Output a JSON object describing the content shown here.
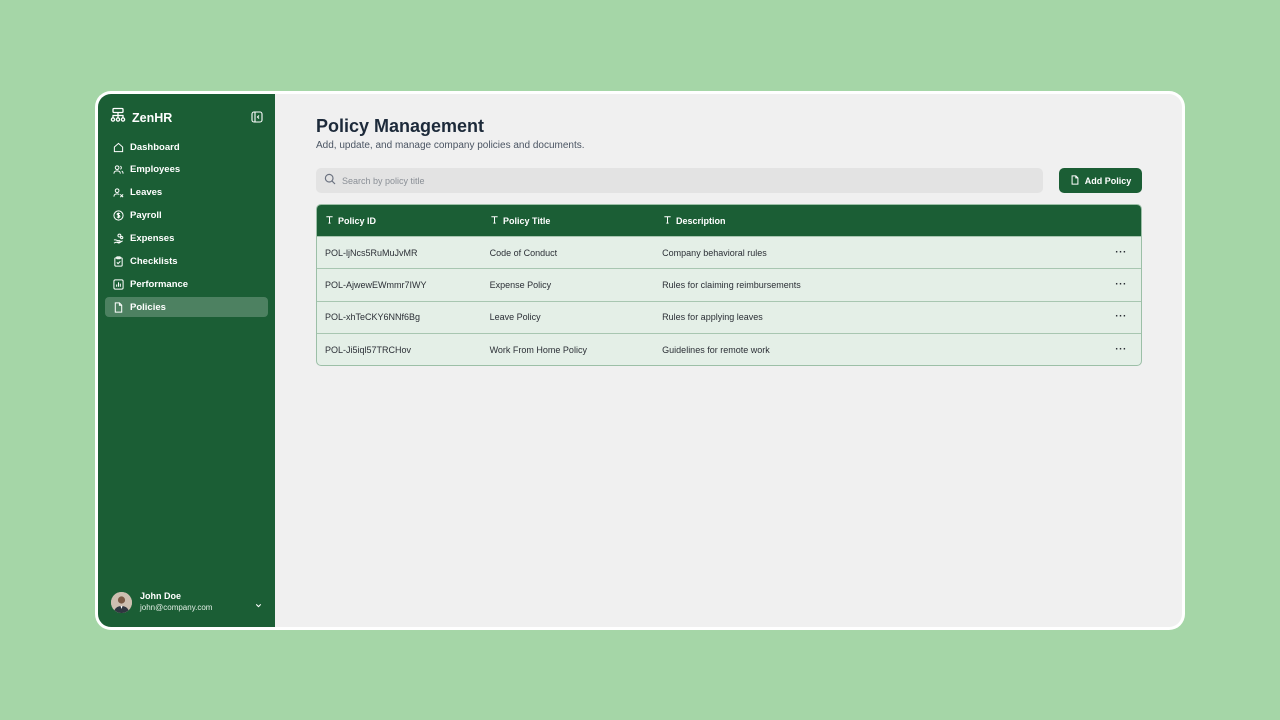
{
  "app": {
    "name": "ZenHR"
  },
  "sidebar": {
    "items": [
      {
        "label": "Dashboard",
        "icon": "home-icon",
        "active": false
      },
      {
        "label": "Employees",
        "icon": "users-icon",
        "active": false
      },
      {
        "label": "Leaves",
        "icon": "user-x-icon",
        "active": false
      },
      {
        "label": "Payroll",
        "icon": "dollar-circle-icon",
        "active": false
      },
      {
        "label": "Expenses",
        "icon": "hand-coins-icon",
        "active": false
      },
      {
        "label": "Checklists",
        "icon": "clipboard-check-icon",
        "active": false
      },
      {
        "label": "Performance",
        "icon": "bar-chart-icon",
        "active": false
      },
      {
        "label": "Policies",
        "icon": "file-icon",
        "active": true
      }
    ]
  },
  "user": {
    "name": "John Doe",
    "email": "john@company.com"
  },
  "page": {
    "title": "Policy Management",
    "subtitle": "Add, update, and manage company policies and documents."
  },
  "search": {
    "placeholder": "Search by policy title",
    "value": ""
  },
  "toolbar": {
    "add_label": "Add Policy"
  },
  "table": {
    "columns": [
      "Policy ID",
      "Policy Title",
      "Description"
    ],
    "rows": [
      {
        "id": "POL-ljNcs5RuMuJvMR",
        "title": "Code of Conduct",
        "description": "Company behavioral rules"
      },
      {
        "id": "POL-AjwewEWmmr7IWY",
        "title": "Expense Policy",
        "description": "Rules for claiming reimbursements"
      },
      {
        "id": "POL-xhTeCKY6NNf6Bg",
        "title": "Leave Policy",
        "description": "Rules for applying leaves"
      },
      {
        "id": "POL-Ji5iql57TRCHov",
        "title": "Work From Home Policy",
        "description": "Guidelines for remote work"
      }
    ],
    "row_action_label": "···"
  },
  "colors": {
    "background": "#a5d6a7",
    "sidebar": "#1b5e35",
    "accent": "#1b5e35",
    "table_row": "#e4efe7"
  }
}
